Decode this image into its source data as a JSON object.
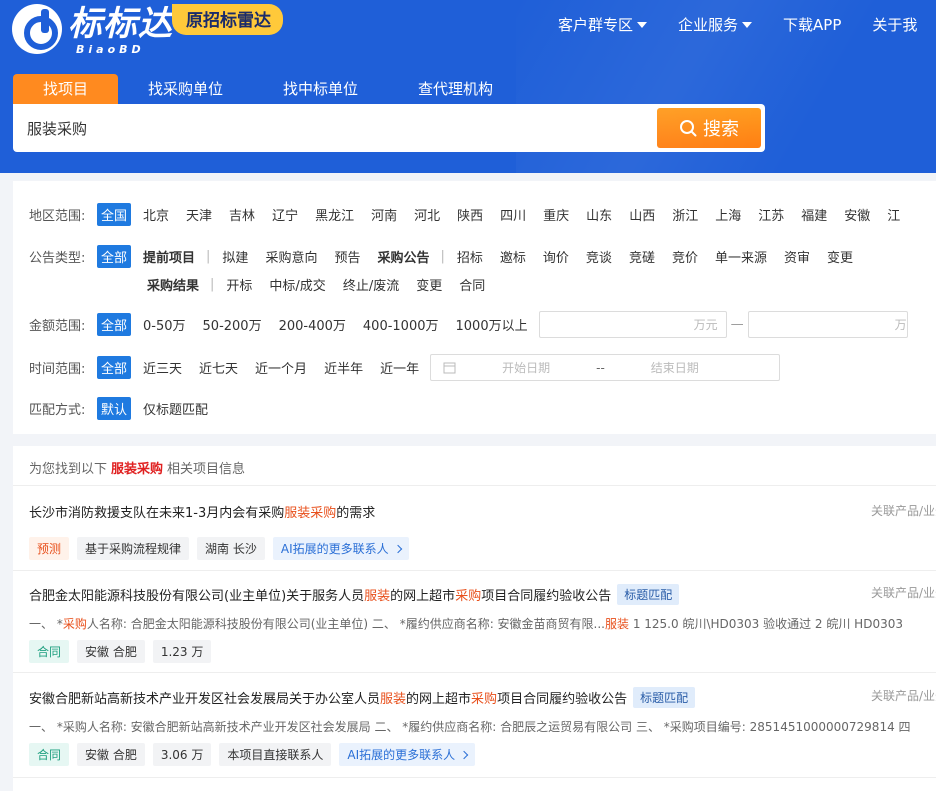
{
  "brand": {
    "name": "标标达",
    "en": "BiaoBD",
    "badge": "原招标雷达"
  },
  "topnav": [
    {
      "label": "客户群专区",
      "dropdown": true
    },
    {
      "label": "企业服务",
      "dropdown": true
    },
    {
      "label": "下载APP",
      "dropdown": false
    },
    {
      "label": "关于我",
      "dropdown": false
    }
  ],
  "search": {
    "tabs": [
      "找项目",
      "找采购单位",
      "找中标单位",
      "查代理机构"
    ],
    "value": "服装采购",
    "button": "搜索"
  },
  "filters": {
    "region": {
      "label": "地区范围:",
      "options": [
        "全国",
        "北京",
        "天津",
        "吉林",
        "辽宁",
        "黑龙江",
        "河南",
        "河北",
        "陕西",
        "四川",
        "重庆",
        "山东",
        "山西",
        "浙江",
        "上海",
        "江苏",
        "福建",
        "安徽",
        "江"
      ]
    },
    "notice": {
      "label": "公告类型:",
      "all": "全部",
      "row1": [
        {
          "label": "提前项目",
          "bold": true,
          "sep": true
        },
        {
          "label": "拟建"
        },
        {
          "label": "采购意向"
        },
        {
          "label": "预告"
        },
        {
          "label": "采购公告",
          "bold": true,
          "sep": true
        },
        {
          "label": "招标"
        },
        {
          "label": "邀标"
        },
        {
          "label": "询价"
        },
        {
          "label": "竞谈"
        },
        {
          "label": "竞磋"
        },
        {
          "label": "竞价"
        },
        {
          "label": "单一来源"
        },
        {
          "label": "资审"
        },
        {
          "label": "变更"
        }
      ],
      "row2": [
        {
          "label": "采购结果",
          "bold": true,
          "sep": true
        },
        {
          "label": "开标"
        },
        {
          "label": "中标/成交"
        },
        {
          "label": "终止/废流"
        },
        {
          "label": "变更"
        },
        {
          "label": "合同"
        }
      ]
    },
    "amount": {
      "label": "金额范围:",
      "options": [
        "全部",
        "0-50万",
        "50-200万",
        "200-400万",
        "400-1000万",
        "1000万以上"
      ],
      "unit1": "万元",
      "unit2": "万"
    },
    "time": {
      "label": "时间范围:",
      "options": [
        "全部",
        "近三天",
        "近七天",
        "近一个月",
        "近半年",
        "近一年"
      ],
      "start": "开始日期",
      "to": "--",
      "end": "结束日期"
    },
    "match": {
      "label": "匹配方式:",
      "options": [
        "默认",
        "仅标题匹配"
      ]
    }
  },
  "results": {
    "header_pre": "为您找到以下",
    "keyword": "服装采购",
    "header_post": "相关项目信息",
    "assoc_label": "关联产品/业务话",
    "items": [
      {
        "title_a": "长沙市消防救援支队在未来1-3月内会有采购",
        "title_hl": "服装采购",
        "title_b": "的需求",
        "tags": {
          "t1": "预测",
          "t2": "基于采购流程规律",
          "t3": "湖南 长沙",
          "t4": "AI拓展的更多联系人"
        }
      },
      {
        "title_a": "合肥金太阳能源科技股份有限公司(业主单位)关于服务人员",
        "title_hl": "服装",
        "title_b": "的网上超市",
        "title_hl2": "采购",
        "title_c": "项目合同履约验收公告",
        "match": "标题匹配",
        "desc_a": "一、 *",
        "desc_hl": "采购",
        "desc_b": "人名称:  合肥金太阳能源科技股份有限公司(业主单位) 二、 *履约供应商名称:  安徽金苗商贸有限...",
        "desc_hl2": "服装",
        "desc_c": " 1 125.0 皖川\\HD0303 验收通过 2 皖川 HD0303",
        "tags": {
          "t1": "合同",
          "t2": "安徽 合肥",
          "t3": "1.23 万"
        }
      },
      {
        "title_a": "安徽合肥新站高新技术产业开发区社会发展局关于办公室人员",
        "title_hl": "服装",
        "title_b": "的网上超市",
        "title_hl2": "采购",
        "title_c": "项目合同履约验收公告",
        "match": "标题匹配",
        "desc": "一、 *采购人名称:  安徽合肥新站高新技术产业开发区社会发展局 二、 *履约供应商名称:  合肥辰之运贸易有限公司 三、 *采购项目编号:  2851451000000729814 四",
        "tags": {
          "t1": "合同",
          "t2": "安徽 合肥",
          "t3": "3.06 万",
          "t4": "本项目直接联系人",
          "t5": "AI拓展的更多联系人"
        }
      }
    ]
  }
}
